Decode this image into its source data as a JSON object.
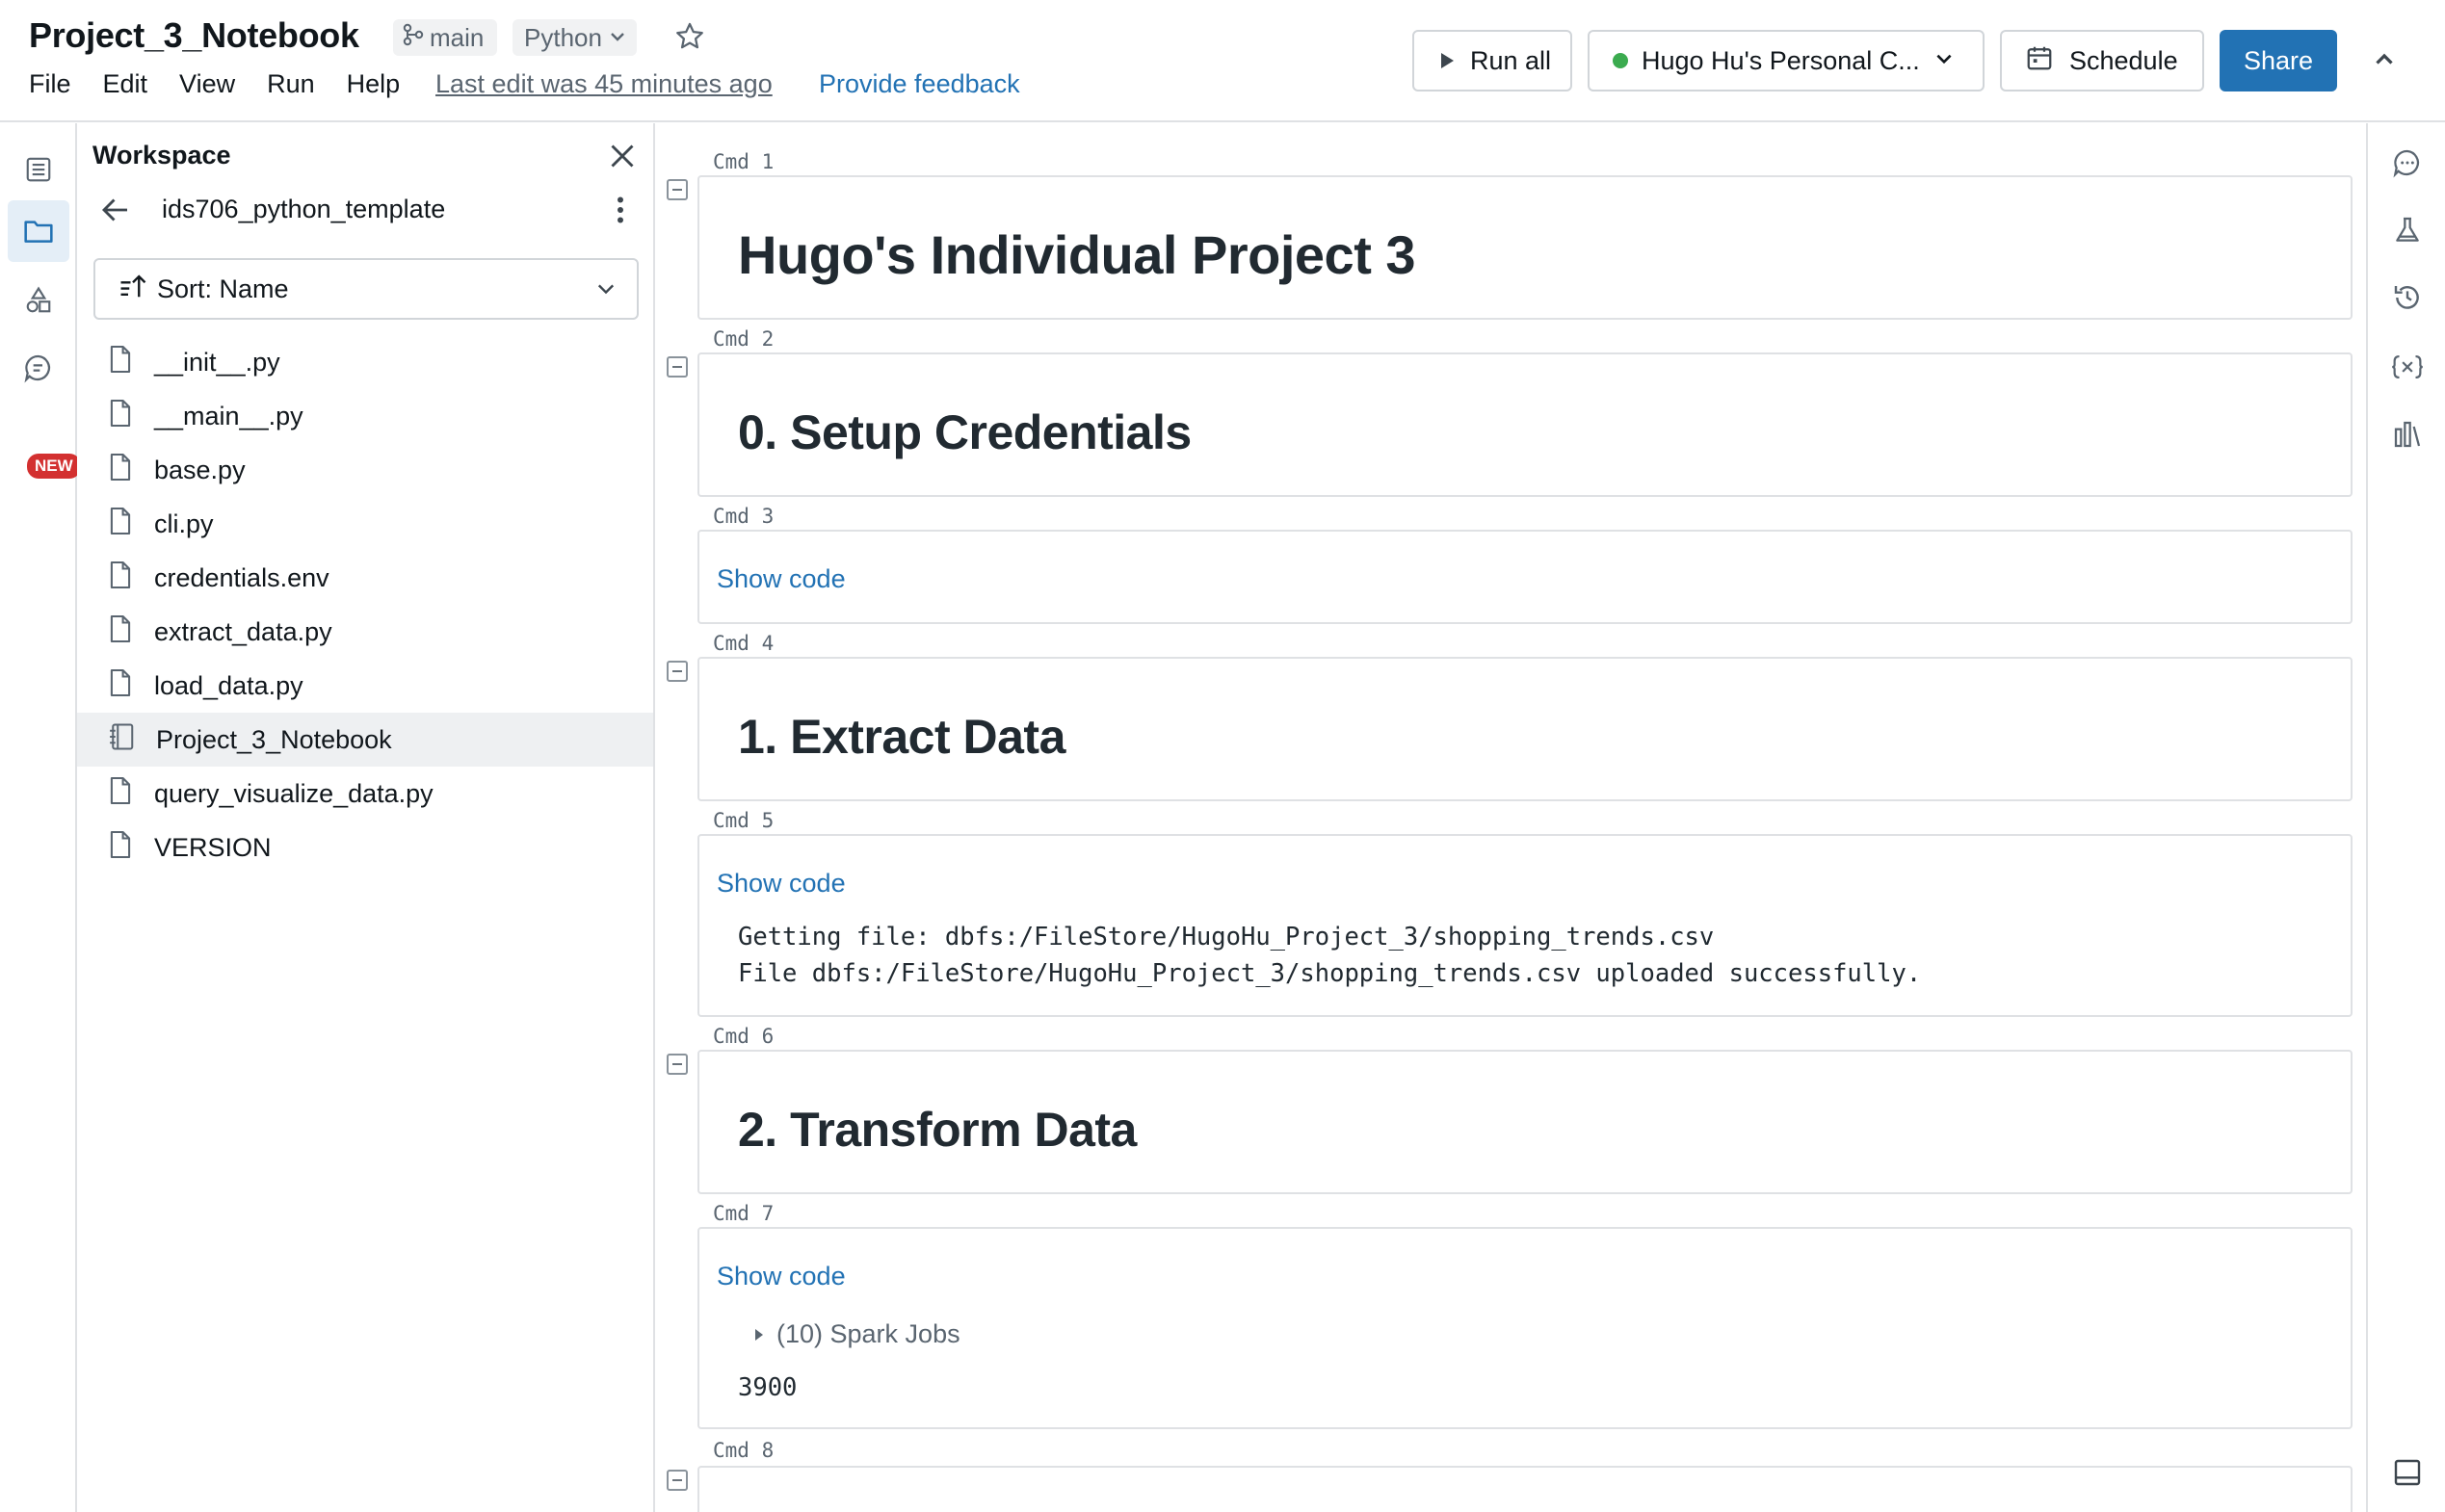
{
  "header": {
    "title": "Project_3_Notebook",
    "branch": "main",
    "language": "Python",
    "menu": [
      "File",
      "Edit",
      "View",
      "Run",
      "Help"
    ],
    "last_edit": "Last edit was 45 minutes ago",
    "feedback": "Provide feedback",
    "run_all": "Run all",
    "cluster": "Hugo Hu's Personal C...",
    "schedule": "Schedule",
    "share": "Share"
  },
  "left_rail": {
    "new_badge": "NEW"
  },
  "workspace": {
    "title": "Workspace",
    "folder": "ids706_python_template",
    "sort": "Sort: Name",
    "files": [
      {
        "name": "__init__.py",
        "type": "file"
      },
      {
        "name": "__main__.py",
        "type": "file"
      },
      {
        "name": "base.py",
        "type": "file"
      },
      {
        "name": "cli.py",
        "type": "file"
      },
      {
        "name": "credentials.env",
        "type": "file"
      },
      {
        "name": "extract_data.py",
        "type": "file"
      },
      {
        "name": "load_data.py",
        "type": "file"
      },
      {
        "name": "Project_3_Notebook",
        "type": "notebook",
        "selected": true
      },
      {
        "name": "query_visualize_data.py",
        "type": "file"
      },
      {
        "name": "VERSION",
        "type": "file"
      }
    ]
  },
  "cells": {
    "cmd1": {
      "label": "Cmd 1",
      "heading": "Hugo's Individual Project 3"
    },
    "cmd2": {
      "label": "Cmd 2",
      "heading": "0. Setup Credentials"
    },
    "cmd3": {
      "label": "Cmd 3",
      "show_code": "Show code"
    },
    "cmd4": {
      "label": "Cmd 4",
      "heading": "1. Extract Data"
    },
    "cmd5": {
      "label": "Cmd 5",
      "show_code": "Show code",
      "output_line1": "Getting file: dbfs:/FileStore/HugoHu_Project_3/shopping_trends.csv",
      "output_line2": "File dbfs:/FileStore/HugoHu_Project_3/shopping_trends.csv uploaded successfully."
    },
    "cmd6": {
      "label": "Cmd 6",
      "heading": "2. Transform Data"
    },
    "cmd7": {
      "label": "Cmd 7",
      "show_code": "Show code",
      "spark_jobs": "(10) Spark Jobs",
      "output": "3900"
    },
    "cmd8": {
      "label": "Cmd 8"
    }
  },
  "colors": {
    "accent": "#2272b4",
    "cluster_status": "#3bab4f",
    "new_badge": "#d33030"
  }
}
